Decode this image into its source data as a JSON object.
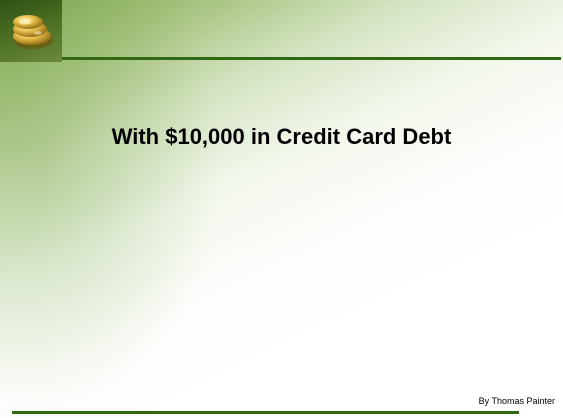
{
  "slide": {
    "title": "With $10,000 in Credit Card Debt",
    "author": "By Thomas Painter"
  },
  "theme": {
    "accent_line": "#2f6a12",
    "gradient_green": "#78a046",
    "logo_icon": "gold-coins-icon"
  }
}
